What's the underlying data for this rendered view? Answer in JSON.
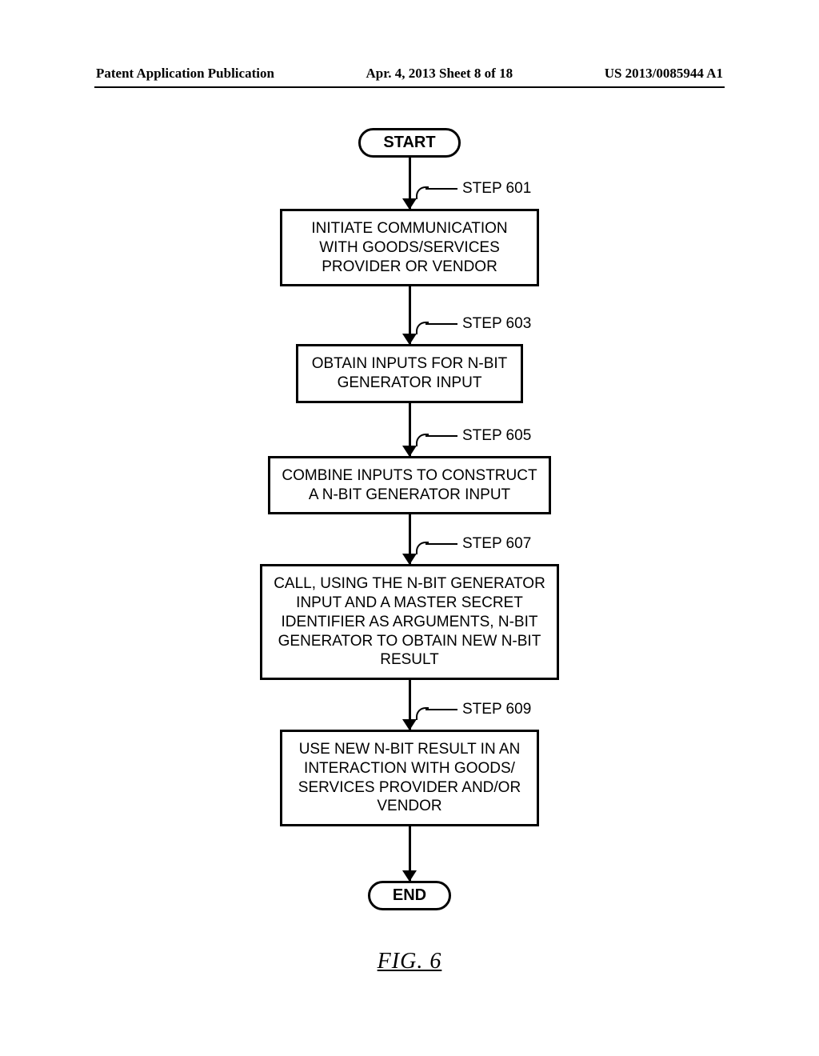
{
  "header": {
    "left": "Patent Application Publication",
    "mid": "Apr. 4, 2013  Sheet 8 of 18",
    "right": "US 2013/0085944 A1"
  },
  "flow": {
    "start": "START",
    "end": "END",
    "figure": "FIG. 6",
    "steps": [
      {
        "label": "STEP 601",
        "text": "INITIATE COMMUNICATION WITH GOODS/SERVICES PROVIDER OR VENDOR"
      },
      {
        "label": "STEP 603",
        "text": "OBTAIN INPUTS FOR N-BIT GENERATOR INPUT"
      },
      {
        "label": "STEP 605",
        "text": "COMBINE INPUTS TO CONSTRUCT A N-BIT GENERATOR INPUT"
      },
      {
        "label": "STEP 607",
        "text": "CALL, USING THE N-BIT GENERATOR INPUT AND A MASTER SECRET IDENTIFIER AS ARGUMENTS, N-BIT GENERATOR TO OBTAIN NEW N-BIT RESULT"
      },
      {
        "label": "STEP 609",
        "text": "USE NEW N-BIT RESULT IN AN INTERACTION WITH GOODS/ SERVICES PROVIDER AND/OR VENDOR"
      }
    ]
  }
}
